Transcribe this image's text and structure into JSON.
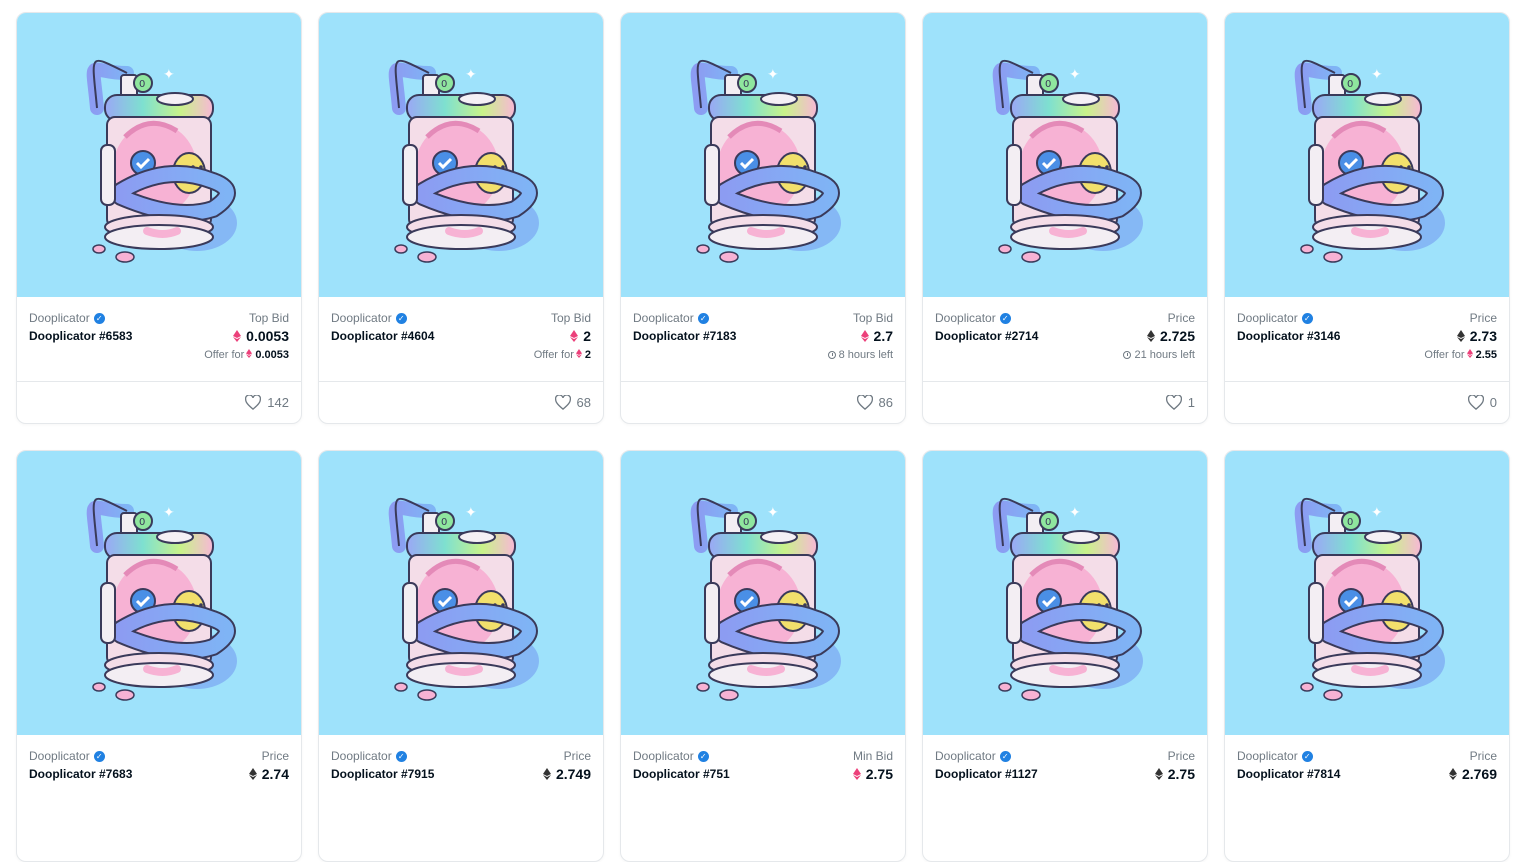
{
  "collection": "Dooplicator",
  "cards": [
    {
      "name": "Dooplicator #6583",
      "label": "Top Bid",
      "price": "0.0053",
      "currency": "weth",
      "sub": {
        "type": "offer",
        "text": "Offer for",
        "amount": "0.0053",
        "currency": "weth"
      },
      "favorites": "142"
    },
    {
      "name": "Dooplicator #4604",
      "label": "Top Bid",
      "price": "2",
      "currency": "weth",
      "sub": {
        "type": "offer",
        "text": "Offer for",
        "amount": "2",
        "currency": "weth"
      },
      "favorites": "68"
    },
    {
      "name": "Dooplicator #7183",
      "label": "Top Bid",
      "price": "2.7",
      "currency": "weth",
      "sub": {
        "type": "time",
        "text": "8 hours left"
      },
      "favorites": "86"
    },
    {
      "name": "Dooplicator #2714",
      "label": "Price",
      "price": "2.725",
      "currency": "eth",
      "sub": {
        "type": "time",
        "text": "21 hours left"
      },
      "favorites": "1"
    },
    {
      "name": "Dooplicator #3146",
      "label": "Price",
      "price": "2.73",
      "currency": "eth",
      "sub": {
        "type": "offer",
        "text": "Offer for",
        "amount": "2.55",
        "currency": "weth"
      },
      "favorites": "0"
    },
    {
      "name": "Dooplicator #7683",
      "label": "Price",
      "price": "2.74",
      "currency": "eth"
    },
    {
      "name": "Dooplicator #7915",
      "label": "Price",
      "price": "2.749",
      "currency": "eth"
    },
    {
      "name": "Dooplicator #751",
      "label": "Min Bid",
      "price": "2.75",
      "currency": "weth"
    },
    {
      "name": "Dooplicator #1127",
      "label": "Price",
      "price": "2.75",
      "currency": "eth"
    },
    {
      "name": "Dooplicator #7814",
      "label": "Price",
      "price": "2.769",
      "currency": "eth"
    }
  ],
  "colors": {
    "art_bg": "#9ee2fb",
    "eth": "#333333",
    "weth": "#ec407a",
    "verified": "#2081e2",
    "muted": "#707a83"
  },
  "icons": {
    "verified": "verified-badge-icon",
    "eth": "eth-icon",
    "weth": "weth-icon",
    "clock": "clock-icon",
    "favorite": "heart-icon"
  }
}
